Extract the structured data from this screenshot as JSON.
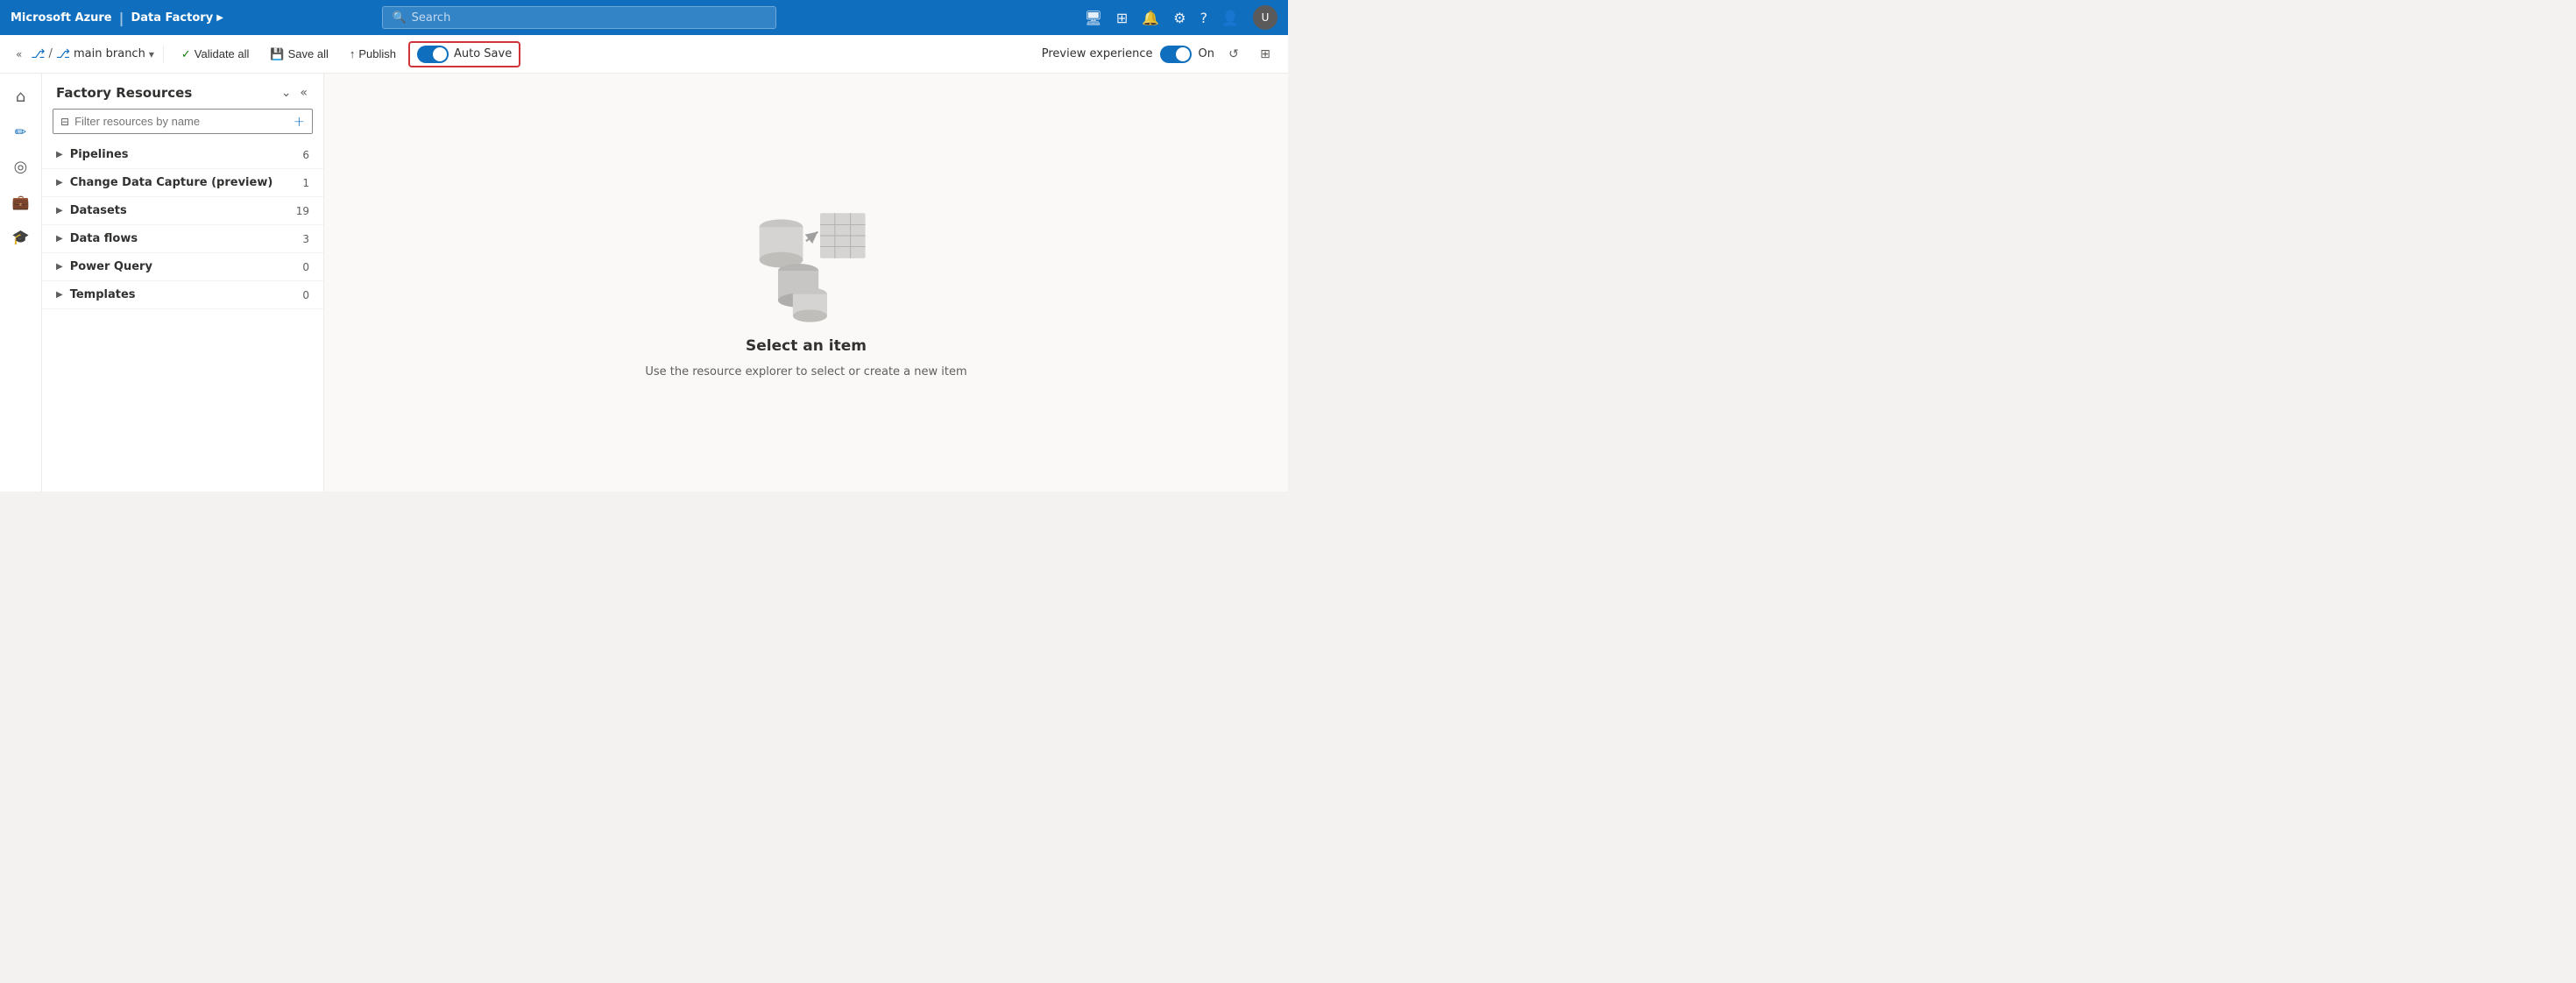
{
  "app": {
    "brand": "Microsoft Azure",
    "separator": "|",
    "product": "Data Factory",
    "product_chevron": "▶",
    "search_placeholder": "Search"
  },
  "toolbar": {
    "collapse_icon": "«",
    "branch_icon": "⎇",
    "branch_name": "main branch",
    "branch_chevron": "▾",
    "validate_all_label": "Validate all",
    "save_all_label": "Save all",
    "publish_label": "Publish",
    "autosave_label": "Auto Save",
    "preview_experience_label": "Preview experience",
    "preview_on_label": "On"
  },
  "nav_icons": {
    "screen": "⬜",
    "grid": "⊞",
    "bell": "🔔",
    "gear": "⚙",
    "question": "?",
    "user_switch": "👤"
  },
  "sidebar": {
    "items": [
      {
        "id": "home",
        "icon": "⌂",
        "active": false
      },
      {
        "id": "edit",
        "icon": "✏",
        "active": true
      },
      {
        "id": "monitor",
        "icon": "◎",
        "active": false
      },
      {
        "id": "manage",
        "icon": "💼",
        "active": false
      },
      {
        "id": "learn",
        "icon": "🎓",
        "active": false
      }
    ]
  },
  "factory_resources": {
    "title": "Factory Resources",
    "filter_placeholder": "Filter resources by name",
    "items": [
      {
        "name": "Pipelines",
        "count": 6
      },
      {
        "name": "Change Data Capture (preview)",
        "count": 1
      },
      {
        "name": "Datasets",
        "count": 19
      },
      {
        "name": "Data flows",
        "count": 3
      },
      {
        "name": "Power Query",
        "count": 0
      },
      {
        "name": "Templates",
        "count": 0
      }
    ]
  },
  "main_content": {
    "title": "Select an item",
    "subtitle": "Use the resource explorer to select or create a new item"
  }
}
